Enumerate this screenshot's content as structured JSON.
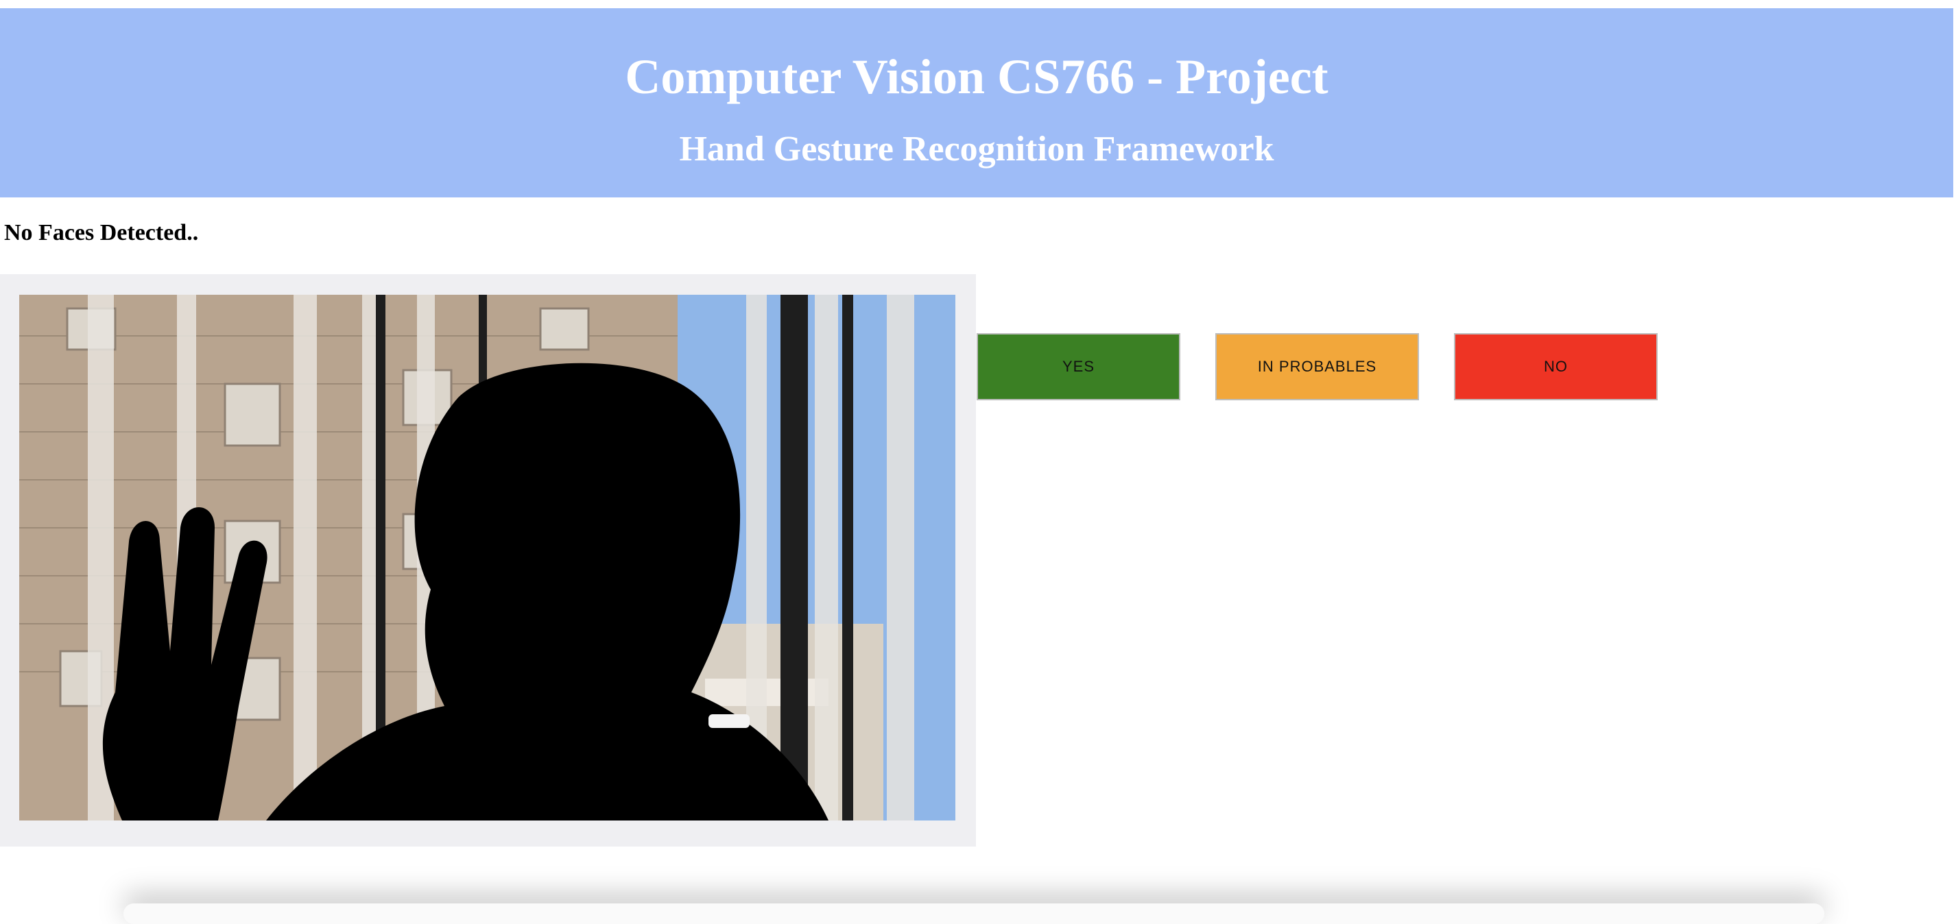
{
  "header": {
    "title": "Computer Vision CS766 - Project",
    "subtitle": "Hand Gesture Recognition Framework"
  },
  "status": {
    "text": "No Faces Detected.."
  },
  "video": {
    "description_icon": "webcam-feed"
  },
  "buttons": {
    "yes_label": "YES",
    "maybe_label": "IN PROBABLES",
    "no_label": "NO"
  },
  "colors": {
    "header_bg": "#9ebcf7",
    "yes": "#3b8024",
    "maybe": "#f2a73b",
    "no": "#ee3424",
    "panel_bg": "#efeff2"
  }
}
